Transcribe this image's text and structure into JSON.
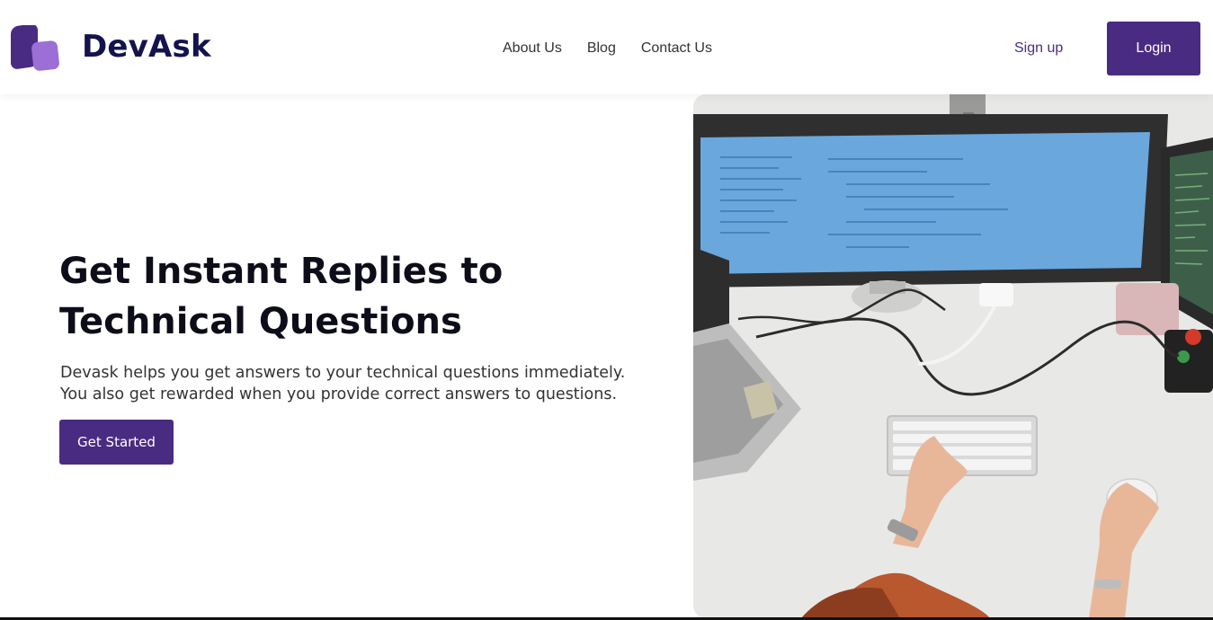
{
  "header": {
    "brand": "DevAsk",
    "nav": [
      "About Us",
      "Blog",
      "Contact Us"
    ],
    "signup_label": "Sign up",
    "login_label": "Login"
  },
  "hero": {
    "title_line1": "Get Instant Replies to",
    "title_line2": "Technical Questions",
    "desc_line1": "Devask helps you get answers to your technical questions immediately.",
    "desc_line2": "You also get rewarded when you provide correct answers to questions.",
    "cta_label": "Get Started"
  },
  "colors": {
    "brand_purple": "#4a2b82",
    "logo_light": "#9b6fd6",
    "brand_text": "#14134e"
  },
  "icons": {
    "logo": "devask-logo-icon"
  }
}
